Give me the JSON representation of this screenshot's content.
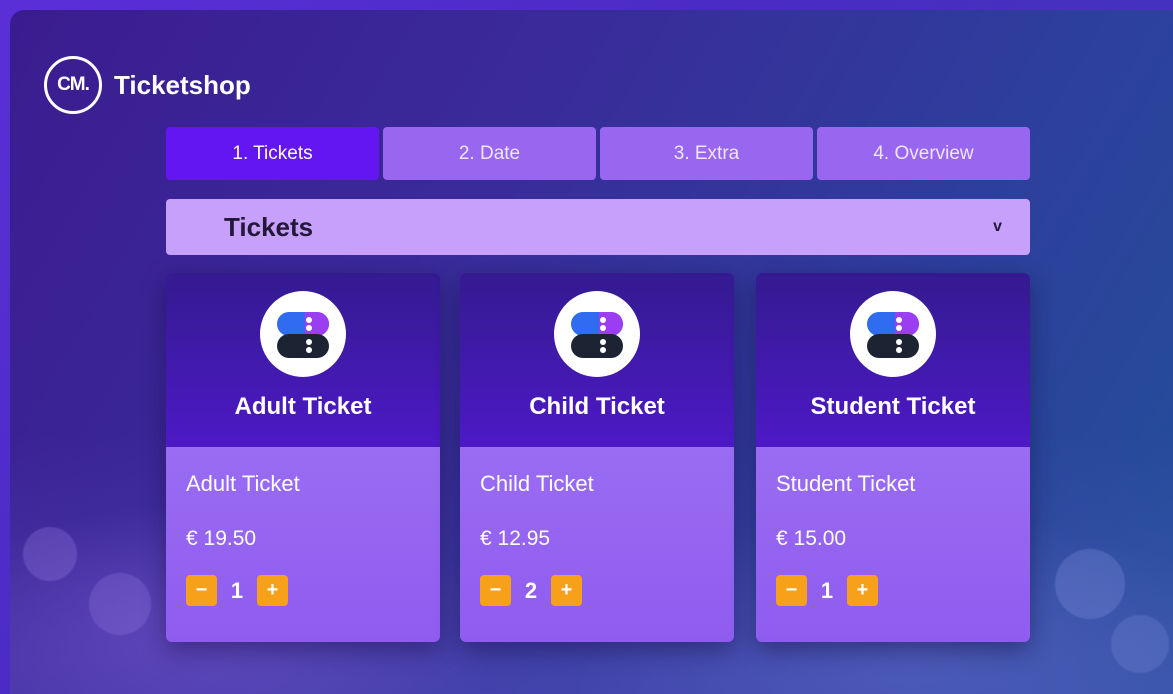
{
  "brand": {
    "logo_text": "CM.",
    "name": "Ticketshop"
  },
  "steps": [
    {
      "label": "1. Tickets",
      "active": true
    },
    {
      "label": "2. Date",
      "active": false
    },
    {
      "label": "3. Extra",
      "active": false
    },
    {
      "label": "4. Overview",
      "active": false
    }
  ],
  "section": {
    "title": "Tickets",
    "toggle": "v"
  },
  "tickets": [
    {
      "header": "Adult Ticket",
      "name": "Adult Ticket",
      "price": "€ 19.50",
      "minus": "−",
      "quantity": "1",
      "plus": "+"
    },
    {
      "header": "Child Ticket",
      "name": "Child Ticket",
      "price": "€ 12.95",
      "minus": "−",
      "quantity": "2",
      "plus": "+"
    },
    {
      "header": "Student Ticket",
      "name": "Student Ticket",
      "price": "€ 15.00",
      "minus": "−",
      "quantity": "1",
      "plus": "+"
    }
  ],
  "colors": {
    "active_step": "#6316f2",
    "step": "#9966f0",
    "section_bar": "#c6a0fb",
    "qty_button": "#f7a11a",
    "icon_blue": "#2f6cf0",
    "icon_purple": "#9b3df0",
    "icon_dark": "#1c2433"
  }
}
